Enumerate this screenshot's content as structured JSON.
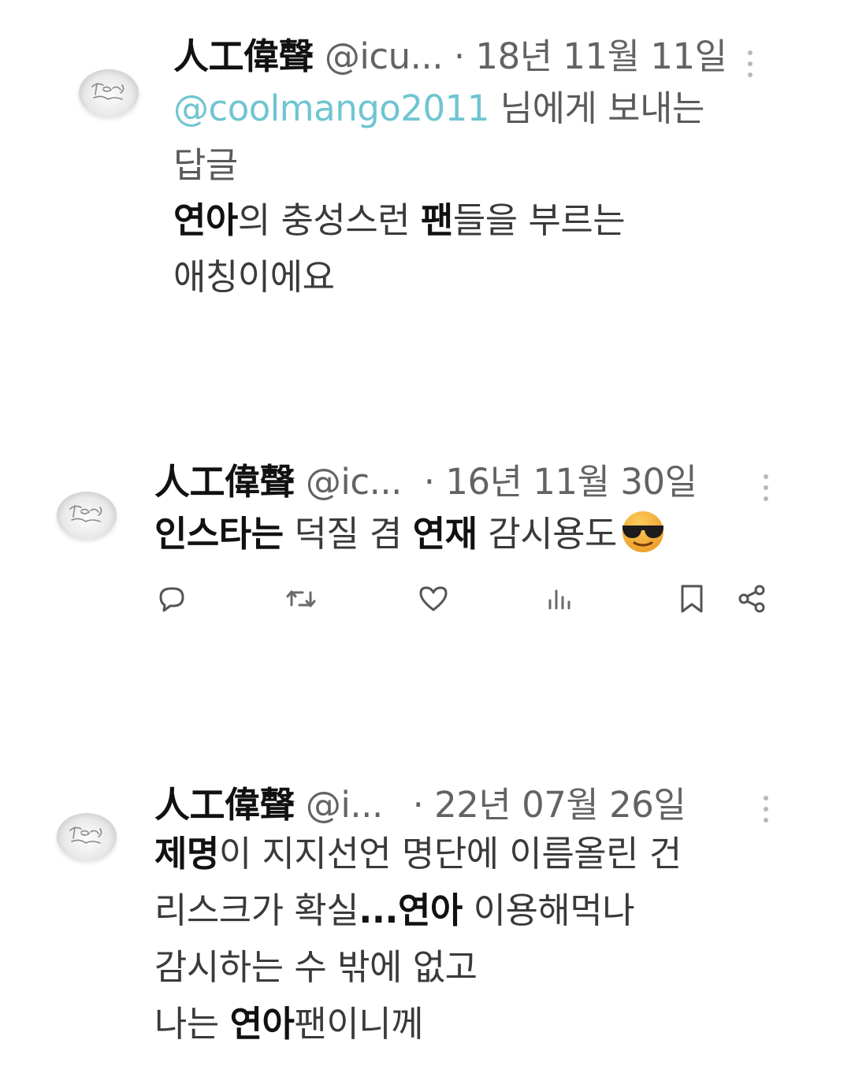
{
  "tweets": [
    {
      "display_name": "人工偉聲",
      "handle": "@icu...",
      "date": "· 18년 11월 11일",
      "reply_to_handle": "@coolmango2011",
      "reply_to_suffix": " 님에게 보내는",
      "reply_to_line2": "답글",
      "body": {
        "l1_b1": "연아",
        "l1_t1": "의 충성스런 ",
        "l1_b2": "팬",
        "l1_t2": "들을 부르는",
        "l2_t1": "애칭이에요"
      }
    },
    {
      "display_name": "人工偉聲",
      "handle": "@ic...",
      "date": "· 16년 11월 30일",
      "body": {
        "l1_b1": "인스타는",
        "l1_t1": " 덕질 겸 ",
        "l1_b2": "연재",
        "l1_t2": " 감시용도"
      },
      "emoji": "smiling-face-with-sunglasses"
    },
    {
      "display_name": "人工偉聲",
      "handle": "@i...",
      "date": "· 22년 07월 26일",
      "body": {
        "l1_b1": "제명",
        "l1_t1": "이 지지선언 명단에 이름올린 건",
        "l2_t1": "리스크가 확실",
        "l2_b1": "...연아",
        "l2_t2": " 이용해먹나",
        "l3_t1": "감시하는 수 밖에 없고",
        "l4_t1": "나는 ",
        "l4_b1": "연아",
        "l4_t2": "팬이니께"
      }
    }
  ],
  "action_bar": {
    "icons": [
      "reply-icon",
      "retweet-icon",
      "like-icon",
      "views-icon",
      "bookmark-icon",
      "share-icon"
    ]
  },
  "colors": {
    "mention": "#6fc5d1",
    "meta_text": "#636363",
    "icon": "#555555"
  }
}
